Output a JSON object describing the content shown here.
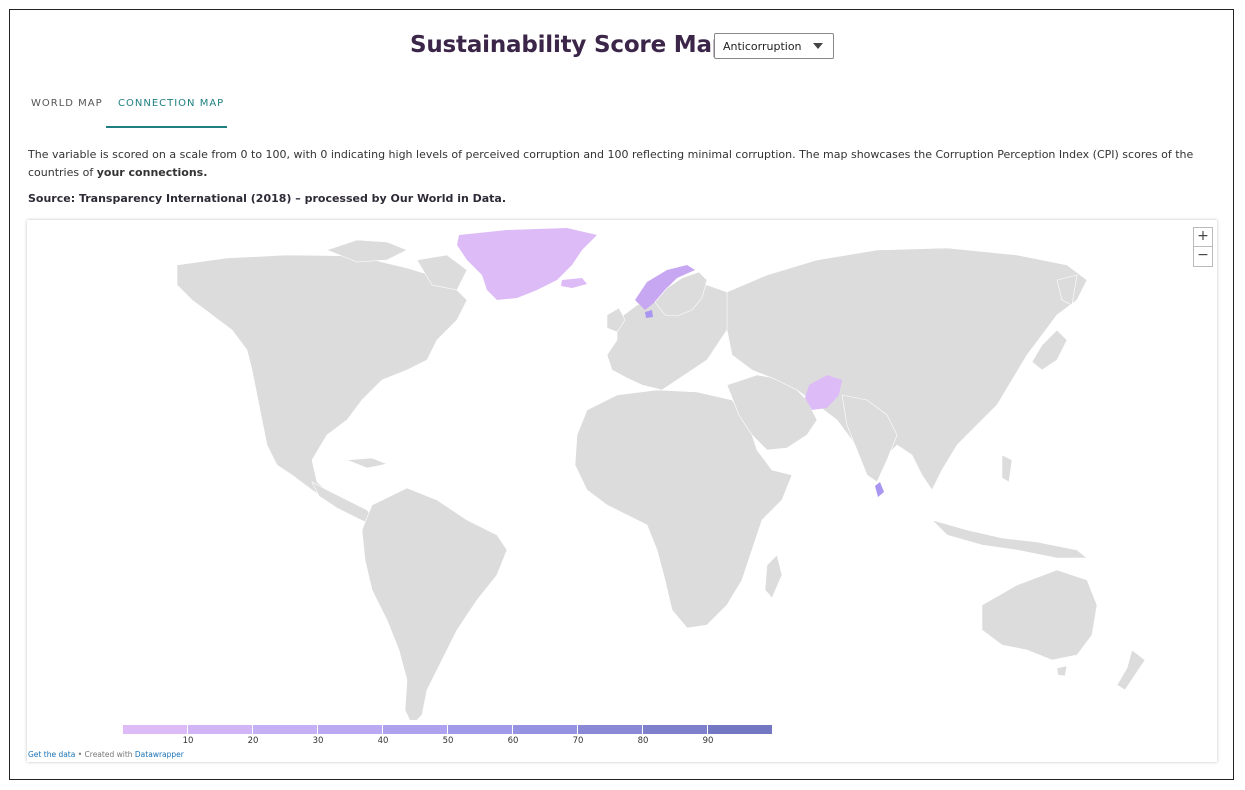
{
  "header": {
    "title": "Sustainability Score Map of",
    "select": {
      "value": "Anticorruption"
    }
  },
  "tabs": [
    {
      "label": "WORLD MAP",
      "active": false
    },
    {
      "label": "CONNECTION MAP",
      "active": true
    }
  ],
  "description": {
    "text": "The variable is scored on a scale from 0 to 100, with 0 indicating high levels of perceived corruption and 100 reflecting minimal corruption. The map showcases the Corruption Perception Index (CPI) scores of the countries of ",
    "bold": "your connections."
  },
  "source": "Source: Transparency International (2018) – processed by Our World in Data.",
  "map": {
    "zoom_in": "+",
    "zoom_out": "−",
    "land_color": "#dcdcdc",
    "highlighted": [
      "Greenland",
      "Norway",
      "Denmark",
      "Afghanistan",
      "Sri Lanka"
    ],
    "legend": {
      "labels": [
        "10",
        "20",
        "30",
        "40",
        "50",
        "60",
        "70",
        "80",
        "90"
      ],
      "colors": [
        "#dcbbf7",
        "#d1b5f6",
        "#c6b0f5",
        "#bba8f2",
        "#aea2ef",
        "#a19ae9",
        "#9592e1",
        "#8a89d6",
        "#7e80cc",
        "#7477c2"
      ]
    },
    "credits": {
      "get_data": "Get the data",
      "created_with": " • Created with ",
      "tool": "Datawrapper"
    }
  }
}
